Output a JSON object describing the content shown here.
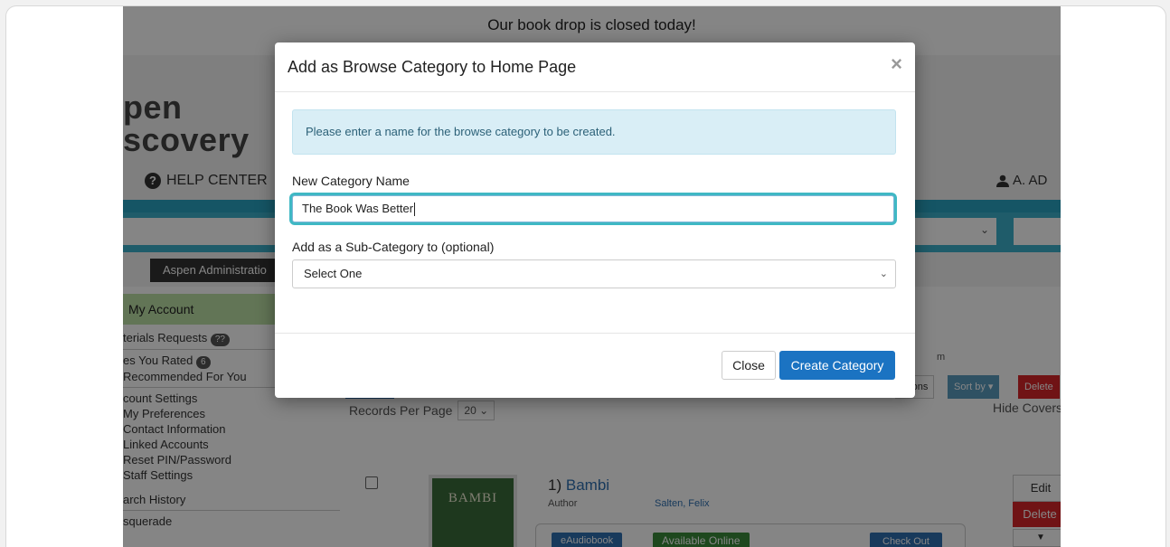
{
  "banner": {
    "text": "Our book drop is closed today!"
  },
  "header": {
    "logo_line1": "pen",
    "logo_line2": "scovery",
    "help_label": "HELP CENTER",
    "user_label": "A. AD"
  },
  "admin_menu": {
    "label": "Aspen Administratio"
  },
  "sidebar": {
    "my_account": "My Account",
    "materials_requests": "terials Requests",
    "materials_badge": "??",
    "titles_rated": "es You Rated",
    "titles_rated_badge": "6",
    "recommended": "Recommended For You",
    "account_settings": "count Settings",
    "my_preferences": "My Preferences",
    "contact_info": "Contact Information",
    "linked_accounts": "Linked Accounts",
    "reset_pin": "Reset PIN/Password",
    "staff_settings": "Staff Settings",
    "search_history": "arch History",
    "masquerade": "squerade"
  },
  "main": {
    "records_per_page": "Records Per Page",
    "records_value": "20",
    "hide_covers": "Hide Covers",
    "partial_m": "m",
    "btn_ations": "ations",
    "btn_sortby": "Sort by",
    "btn_delete": "Delete",
    "result": {
      "number": "1)",
      "title": "Bambi",
      "author_label": "Author",
      "author_value": "Salten, Felix",
      "format": "eAudiobook",
      "status": "Available Online",
      "checkout": "Check Out",
      "edit": "Edit",
      "delete": "Delete",
      "cover_text": "BAMBI"
    }
  },
  "modal": {
    "title": "Add as Browse Category to Home Page",
    "close_icon": "×",
    "alert": "Please enter a name for the browse category to be created.",
    "name_label": "New Category Name",
    "name_value": "The Book Was Better",
    "sub_label": "Add as a Sub-Category to (optional)",
    "sub_value": "Select One",
    "close_button": "Close",
    "create_button": "Create Category"
  }
}
